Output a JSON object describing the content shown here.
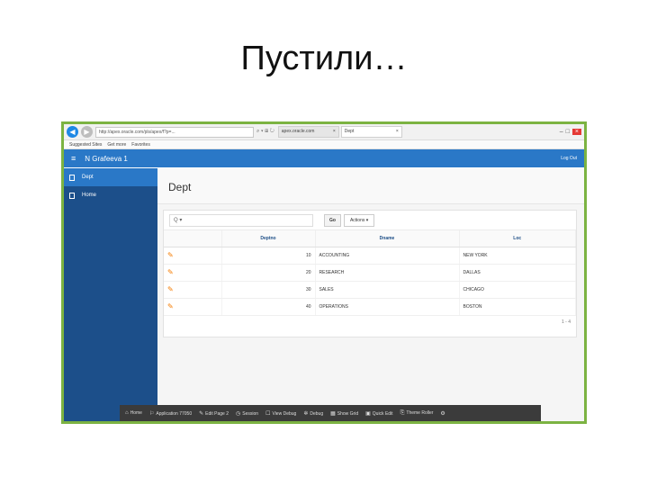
{
  "slide": {
    "title": "Пустили…"
  },
  "browser": {
    "address": "http://apex.oracle.com/pls/apex/f?p=...",
    "tabs": [
      {
        "label": "apex.oracle.com",
        "close": "×"
      },
      {
        "label": "Dept",
        "close": "×"
      }
    ],
    "favorites": [
      "Suggested Sites",
      "Get more",
      "Favorites"
    ]
  },
  "app": {
    "title": "N Grafeeva 1",
    "logout_label": "Log Out",
    "sidebar": [
      {
        "label": "Dept",
        "active": true
      },
      {
        "label": "Home",
        "active": false
      }
    ],
    "page_heading": "Dept",
    "report": {
      "search_icon": "Q ▾",
      "go_label": "Go",
      "actions_label": "Actions ▾",
      "columns": [
        "",
        "Deptno",
        "Dname",
        "Loc"
      ],
      "rows": [
        {
          "deptno": "10",
          "dname": "ACCOUNTING",
          "loc": "NEW YORK"
        },
        {
          "deptno": "20",
          "dname": "RESEARCH",
          "loc": "DALLAS"
        },
        {
          "deptno": "30",
          "dname": "SALES",
          "loc": "CHICAGO"
        },
        {
          "deptno": "40",
          "dname": "OPERATIONS",
          "loc": "BOSTON"
        }
      ],
      "pagination": "1 - 4"
    }
  },
  "dev_toolbar": {
    "items": [
      {
        "icon": "home-icon",
        "label": "Home"
      },
      {
        "icon": "chart-icon",
        "label": "Application 77050"
      },
      {
        "icon": "edit-icon",
        "label": "Edit Page 2"
      },
      {
        "icon": "session-icon",
        "label": "Session"
      },
      {
        "icon": "debug-view-icon",
        "label": "View Debug"
      },
      {
        "icon": "bug-icon",
        "label": "Debug"
      },
      {
        "icon": "grid-icon",
        "label": "Show Grid"
      },
      {
        "icon": "quick-edit-icon",
        "label": "Quick Edit"
      },
      {
        "icon": "theme-icon",
        "label": "Theme Roller"
      },
      {
        "icon": "settings-icon",
        "label": ""
      }
    ]
  }
}
